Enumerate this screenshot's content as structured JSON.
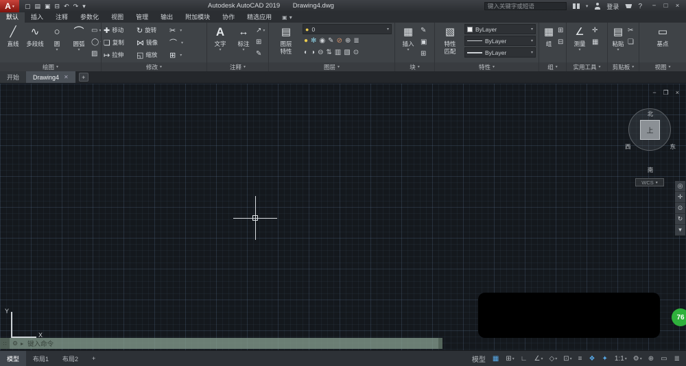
{
  "glyphs": {
    "dropdown": "▾",
    "close": "✕"
  },
  "colors": {
    "accent_blue": "#57a9e8",
    "badge_green": "#2fb13c",
    "command_bar_green": "#8da696",
    "app_red": "#a8231b"
  },
  "titlebar": {
    "app_letter": "A",
    "qat": [
      {
        "name": "qat-new-button",
        "glyph": "▢"
      },
      {
        "name": "qat-open-button",
        "glyph": "▤"
      },
      {
        "name": "qat-save-button",
        "glyph": "▣"
      },
      {
        "name": "qat-plot-button",
        "glyph": "⊟"
      },
      {
        "name": "qat-undo-button",
        "glyph": "↶"
      },
      {
        "name": "qat-redo-button",
        "glyph": "↷"
      },
      {
        "name": "qat-menu-button",
        "glyph": "▾"
      }
    ],
    "title_app": "Autodesk AutoCAD 2019",
    "title_doc": "Drawing4.dwg",
    "search_placeholder": "键入关键字或短语",
    "signin_label": "登录",
    "help_label": "?",
    "window": {
      "minimize": "−",
      "maximize": "□",
      "close": "×"
    }
  },
  "ribbon": {
    "tabs": [
      {
        "label": "默认",
        "active": true,
        "name": "ribbon-tab-home"
      },
      {
        "label": "插入",
        "name": "ribbon-tab-insert"
      },
      {
        "label": "注释",
        "name": "ribbon-tab-annotate"
      },
      {
        "label": "参数化",
        "name": "ribbon-tab-parametric"
      },
      {
        "label": "视图",
        "name": "ribbon-tab-view"
      },
      {
        "label": "管理",
        "name": "ribbon-tab-manage"
      },
      {
        "label": "输出",
        "name": "ribbon-tab-output"
      },
      {
        "label": "附加模块",
        "name": "ribbon-tab-addins"
      },
      {
        "label": "协作",
        "name": "ribbon-tab-collaborate"
      },
      {
        "label": "精选应用",
        "name": "ribbon-tab-featured-apps"
      }
    ],
    "panels": {
      "draw": {
        "label": "绘图",
        "tools": [
          {
            "name": "line-tool",
            "glyph": "╱",
            "label": "直线"
          },
          {
            "name": "polyline-tool",
            "glyph": "∿",
            "label": "多段线"
          },
          {
            "name": "circle-tool",
            "glyph": "○",
            "label": "圆",
            "caret": "▾"
          },
          {
            "name": "arc-tool",
            "glyph": "⌒",
            "label": "圆弧",
            "caret": "▾"
          }
        ],
        "small": [
          {
            "name": "rectangle-tool",
            "glyph": "▭",
            "caret": "▾"
          },
          {
            "name": "ellipse-tool",
            "glyph": "◯",
            "caret": "▾"
          },
          {
            "name": "hatch-tool",
            "glyph": "▨"
          }
        ]
      },
      "modify": {
        "label": "修改",
        "tools": [
          {
            "name": "move-tool",
            "glyph": "✚",
            "label": "移动"
          },
          {
            "name": "rotate-tool",
            "glyph": "↻",
            "label": "旋转"
          },
          {
            "name": "trim-tool",
            "glyph": "✂",
            "caret": "▾"
          },
          {
            "name": "copy-tool",
            "glyph": "❏",
            "label": "复制"
          },
          {
            "name": "mirror-tool",
            "glyph": "⋈",
            "label": "镜像"
          },
          {
            "name": "fillet-tool",
            "glyph": "⌒",
            "caret": "▾"
          },
          {
            "name": "stretch-tool",
            "glyph": "↦",
            "label": "拉伸"
          },
          {
            "name": "scale-tool",
            "glyph": "◱",
            "label": "缩放"
          },
          {
            "name": "array-tool",
            "glyph": "⊞",
            "caret": "▾"
          }
        ]
      },
      "annotation": {
        "label": "注释",
        "text_tool": {
          "big": "A",
          "label": "文字"
        },
        "dim_tool": {
          "glyph": "↔",
          "label": "标注"
        },
        "small": [
          {
            "name": "leader-tool",
            "glyph": "↗",
            "caret": "▾"
          },
          {
            "name": "table-tool",
            "glyph": "⊞"
          },
          {
            "name": "markup-tool",
            "glyph": "✎"
          }
        ]
      },
      "layers": {
        "label": "图层",
        "big_glyph": "▤",
        "properties_label_1": "图层",
        "properties_label_2": "特性",
        "bulb": "●",
        "current": "0",
        "row1": [
          {
            "name": "layer-off-icon",
            "glyph": "●",
            "color": "#eccc4f"
          },
          {
            "name": "layer-freeze-icon",
            "glyph": "✻",
            "color": "#8fd6ea"
          },
          {
            "name": "layer-lock-icon",
            "glyph": "◉"
          },
          {
            "name": "layer-edit-icon",
            "glyph": "✎"
          },
          {
            "name": "layer-isolate-icon",
            "glyph": "⊘",
            "color": "#d8936a"
          },
          {
            "name": "layer-add-icon",
            "glyph": "⊕"
          },
          {
            "name": "layer-states-icon",
            "glyph": "≣"
          }
        ],
        "row2": [
          {
            "name": "layer-tool-icon",
            "glyph": "◐"
          },
          {
            "name": "layer-tool-icon",
            "glyph": "◑"
          },
          {
            "name": "layer-tool-icon",
            "glyph": "⊖"
          },
          {
            "name": "layer-tool-icon",
            "glyph": "⇅"
          },
          {
            "name": "layer-tool-icon",
            "glyph": "▥"
          },
          {
            "name": "layer-tool-icon",
            "glyph": "▧"
          },
          {
            "name": "layer-tool-icon",
            "glyph": "⊙"
          }
        ]
      },
      "block": {
        "label": "块",
        "glyph": "▦",
        "insert_label": "插入",
        "caret": "▾",
        "small": [
          {
            "name": "create-block-tool",
            "glyph": "✎"
          },
          {
            "name": "edit-block-tool",
            "glyph": "▣"
          },
          {
            "name": "block-attribute-tool",
            "glyph": "⊞"
          }
        ]
      },
      "properties": {
        "label": "特性",
        "match_glyph": "▧",
        "match_label_1": "特性",
        "match_label_2": "匹配",
        "color_value": "ByLayer",
        "linetype_value": "ByLayer",
        "lineweight_value": "ByLayer"
      },
      "group": {
        "label": "组",
        "glyph": "▦",
        "group_label": "组",
        "small": [
          {
            "name": "ungroup-tool",
            "glyph": "⊞"
          },
          {
            "name": "group-edit-tool",
            "glyph": "⊟"
          }
        ]
      },
      "utilities": {
        "label": "实用工具",
        "glyph": "∠",
        "measure_label": "测量",
        "caret": "▾",
        "small": [
          {
            "name": "quick-select-tool",
            "glyph": "✛"
          },
          {
            "name": "calculator-tool",
            "glyph": "▦"
          }
        ]
      },
      "clipboard": {
        "label": "剪贴板",
        "glyph": "▤",
        "paste_label": "粘贴",
        "caret": "▾",
        "small": [
          {
            "name": "cut-tool",
            "glyph": "✂"
          },
          {
            "name": "copy-clip-tool",
            "glyph": "❏"
          }
        ]
      },
      "view": {
        "label": "视图",
        "glyph": "▭",
        "base_label": "基点"
      }
    }
  },
  "file_tabs": {
    "start": "开始",
    "doc": "Drawing4",
    "new": "+"
  },
  "canvas": {
    "doc_controls": {
      "minimize": "−",
      "restore": "❐",
      "close": "×"
    },
    "viewcube": {
      "north": "北",
      "south": "南",
      "west": "西",
      "east": "东",
      "top": "上",
      "wcs": "WCS"
    },
    "navbar": [
      {
        "name": "navigation-wheel-icon",
        "glyph": "◎"
      },
      {
        "name": "pan-icon",
        "glyph": "✛"
      },
      {
        "name": "zoom-icon",
        "glyph": "⊙"
      },
      {
        "name": "orbit-icon",
        "glyph": "↻"
      },
      {
        "name": "navbar-more-icon",
        "glyph": "▾"
      }
    ],
    "ucs": {
      "x": "X",
      "y": "Y"
    },
    "command": {
      "grip": "∷",
      "customize": "⚙",
      "chevron": "▸",
      "prompt": "键入命令"
    },
    "badge": "76"
  },
  "statusbar": {
    "layout_tabs": [
      {
        "label": "模型",
        "active": true,
        "name": "model-layout-tab"
      },
      {
        "label": "布局1",
        "name": "layout1-tab"
      },
      {
        "label": "布局2",
        "name": "layout2-tab"
      },
      {
        "label": "+",
        "name": "new-layout-button"
      }
    ],
    "right": [
      {
        "name": "model-space-button",
        "glyph": "模型"
      },
      {
        "name": "grid-icon",
        "glyph": "▦",
        "blue": true
      },
      {
        "name": "snap-icon",
        "glyph": "⊞",
        "caret": "▾"
      },
      {
        "name": "ortho-icon",
        "glyph": "∟"
      },
      {
        "name": "polar-icon",
        "glyph": "∠",
        "caret": "▾"
      },
      {
        "name": "isodraft-icon",
        "glyph": "◇",
        "caret": "▾"
      },
      {
        "name": "osnap-icon",
        "glyph": "⊡",
        "caret": "▾"
      },
      {
        "name": "lineweight-icon",
        "glyph": "≡"
      },
      {
        "name": "annotation-visibility-icon",
        "glyph": "❖",
        "blue": true
      },
      {
        "name": "annotation-autoscale-icon",
        "glyph": "✦",
        "blue": true
      },
      {
        "name": "annotation-scale-button",
        "glyph": "1:1",
        "caret": "▾"
      },
      {
        "name": "workspace-gear-icon",
        "glyph": "⚙",
        "caret": "▾"
      },
      {
        "name": "annotation-monitor-icon",
        "glyph": "⊕"
      },
      {
        "name": "graphics-performance-icon",
        "glyph": "▭"
      },
      {
        "name": "customization-icon",
        "glyph": "≣"
      }
    ]
  }
}
